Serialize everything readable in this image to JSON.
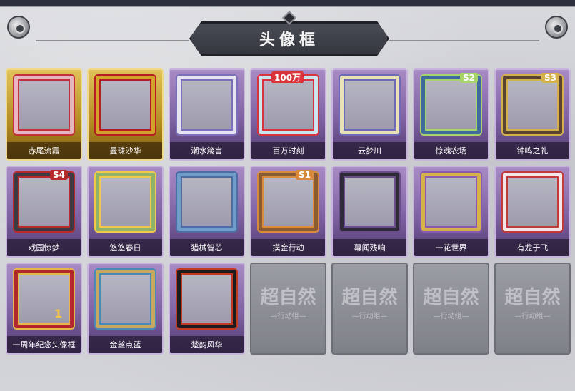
{
  "title": "头像框",
  "frames": [
    {
      "label": "赤尾流霞",
      "style": "gold",
      "border": "#e7b6c0",
      "accent": "#c2303a"
    },
    {
      "label": "曼珠沙华",
      "style": "gold",
      "border": "#d4a12a",
      "accent": "#b51c24"
    },
    {
      "label": "潮水箴言",
      "style": "purple",
      "border": "#e6e3f2",
      "accent": "#7a6fb8"
    },
    {
      "label": "百万时刻",
      "style": "purple",
      "border": "#c9e6ef",
      "accent": "#d9343c",
      "badge": "100万"
    },
    {
      "label": "云梦川",
      "style": "purple",
      "border": "#e9e2b6",
      "accent": "#6c6ab8"
    },
    {
      "label": "惊魂农场",
      "style": "purple",
      "border": "#3e6a9e",
      "accent": "#a6d36a",
      "badge": "S2"
    },
    {
      "label": "钟鸣之礼",
      "style": "purple",
      "border": "#5a4330",
      "accent": "#d4b04a",
      "badge": "S3"
    },
    {
      "label": "戏园惊梦",
      "style": "purple",
      "border": "#3d3a45",
      "accent": "#b62a2a",
      "badge": "S4"
    },
    {
      "label": "悠悠春日",
      "style": "purple",
      "border": "#8eb36a",
      "accent": "#f0c94a"
    },
    {
      "label": "猎械智芯",
      "style": "purple",
      "border": "#6f9cc9",
      "accent": "#4f6da5"
    },
    {
      "label": "摸金行动",
      "style": "purple",
      "border": "#8a5a32",
      "accent": "#d98a3a",
      "badge": "S1"
    },
    {
      "label": "幕闻残响",
      "style": "purple",
      "border": "#2e2a3a",
      "accent": "#6a4c8a"
    },
    {
      "label": "一花世界",
      "style": "purple",
      "border": "#d6b24a",
      "accent": "#8a5ab0"
    },
    {
      "label": "有龙于飞",
      "style": "purple",
      "border": "#f2e6e6",
      "accent": "#c23a3a"
    },
    {
      "label": "一周年纪念头像框",
      "style": "purple",
      "border": "#b2262c",
      "accent": "#e6b84a",
      "badge": "1"
    },
    {
      "label": "金丝点蓝",
      "style": "purple",
      "border": "#c8a860",
      "accent": "#4a8ab8"
    },
    {
      "label": "楚韵风华",
      "style": "purple",
      "border": "#1e1b1e",
      "accent": "#c23a22"
    },
    {
      "label": "",
      "style": "locked",
      "watermark": "超自然",
      "sub": "—行动组—"
    },
    {
      "label": "",
      "style": "locked",
      "watermark": "超自然",
      "sub": "—行动组—"
    },
    {
      "label": "",
      "style": "locked",
      "watermark": "超自然",
      "sub": "—行动组—"
    },
    {
      "label": "",
      "style": "locked",
      "watermark": "超自然",
      "sub": "—行动组—"
    }
  ]
}
